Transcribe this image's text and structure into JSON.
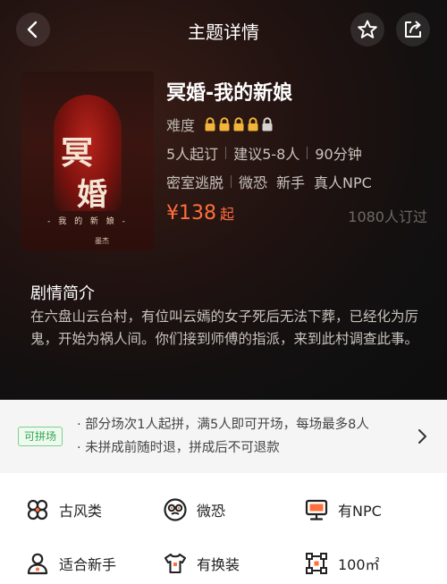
{
  "header": {
    "title": "主题详情"
  },
  "room": {
    "name": "冥婚-我的新娘",
    "difficulty_label": "难度",
    "difficulty": {
      "filled": 4,
      "total": 5
    },
    "specs": [
      "5人起订",
      "建议5-8人",
      "90分钟"
    ],
    "tags_primary": [
      "密室逃脱",
      "微恐"
    ],
    "tags_secondary": [
      "新手",
      "真人NPC"
    ],
    "price": "¥138",
    "price_suffix": "起",
    "booked": "1080人订过"
  },
  "poster": {
    "big1": "冥",
    "big2": "婚",
    "subtitle": "- 我 的 新 娘 -",
    "brand": "墨杰"
  },
  "plot": {
    "title": "剧情简介",
    "text": "在六盘山云台村，有位叫云嫣的女子死后无法下葬，已经化为厉鬼，开始为祸人间。你们接到师傅的指派，来到此村调查此事。"
  },
  "group": {
    "badge": "可拼场",
    "rules": [
      "· 部分场次1人起拼，满5人即可开场，每场最多8人",
      "· 未拼成前随时退，拼成后不可退款"
    ]
  },
  "features": [
    {
      "label": "古风类",
      "icon": "ancient-style-icon"
    },
    {
      "label": "微恐",
      "icon": "mild-horror-icon"
    },
    {
      "label": "有NPC",
      "icon": "npc-icon"
    },
    {
      "label": "适合新手",
      "icon": "beginner-icon"
    },
    {
      "label": "有换装",
      "icon": "costume-icon"
    },
    {
      "label": "100㎡",
      "icon": "area-icon"
    }
  ],
  "colors": {
    "accent": "#ff6f3c",
    "lock_gold": "#f2b53a",
    "badge_green": "#36a84f"
  }
}
